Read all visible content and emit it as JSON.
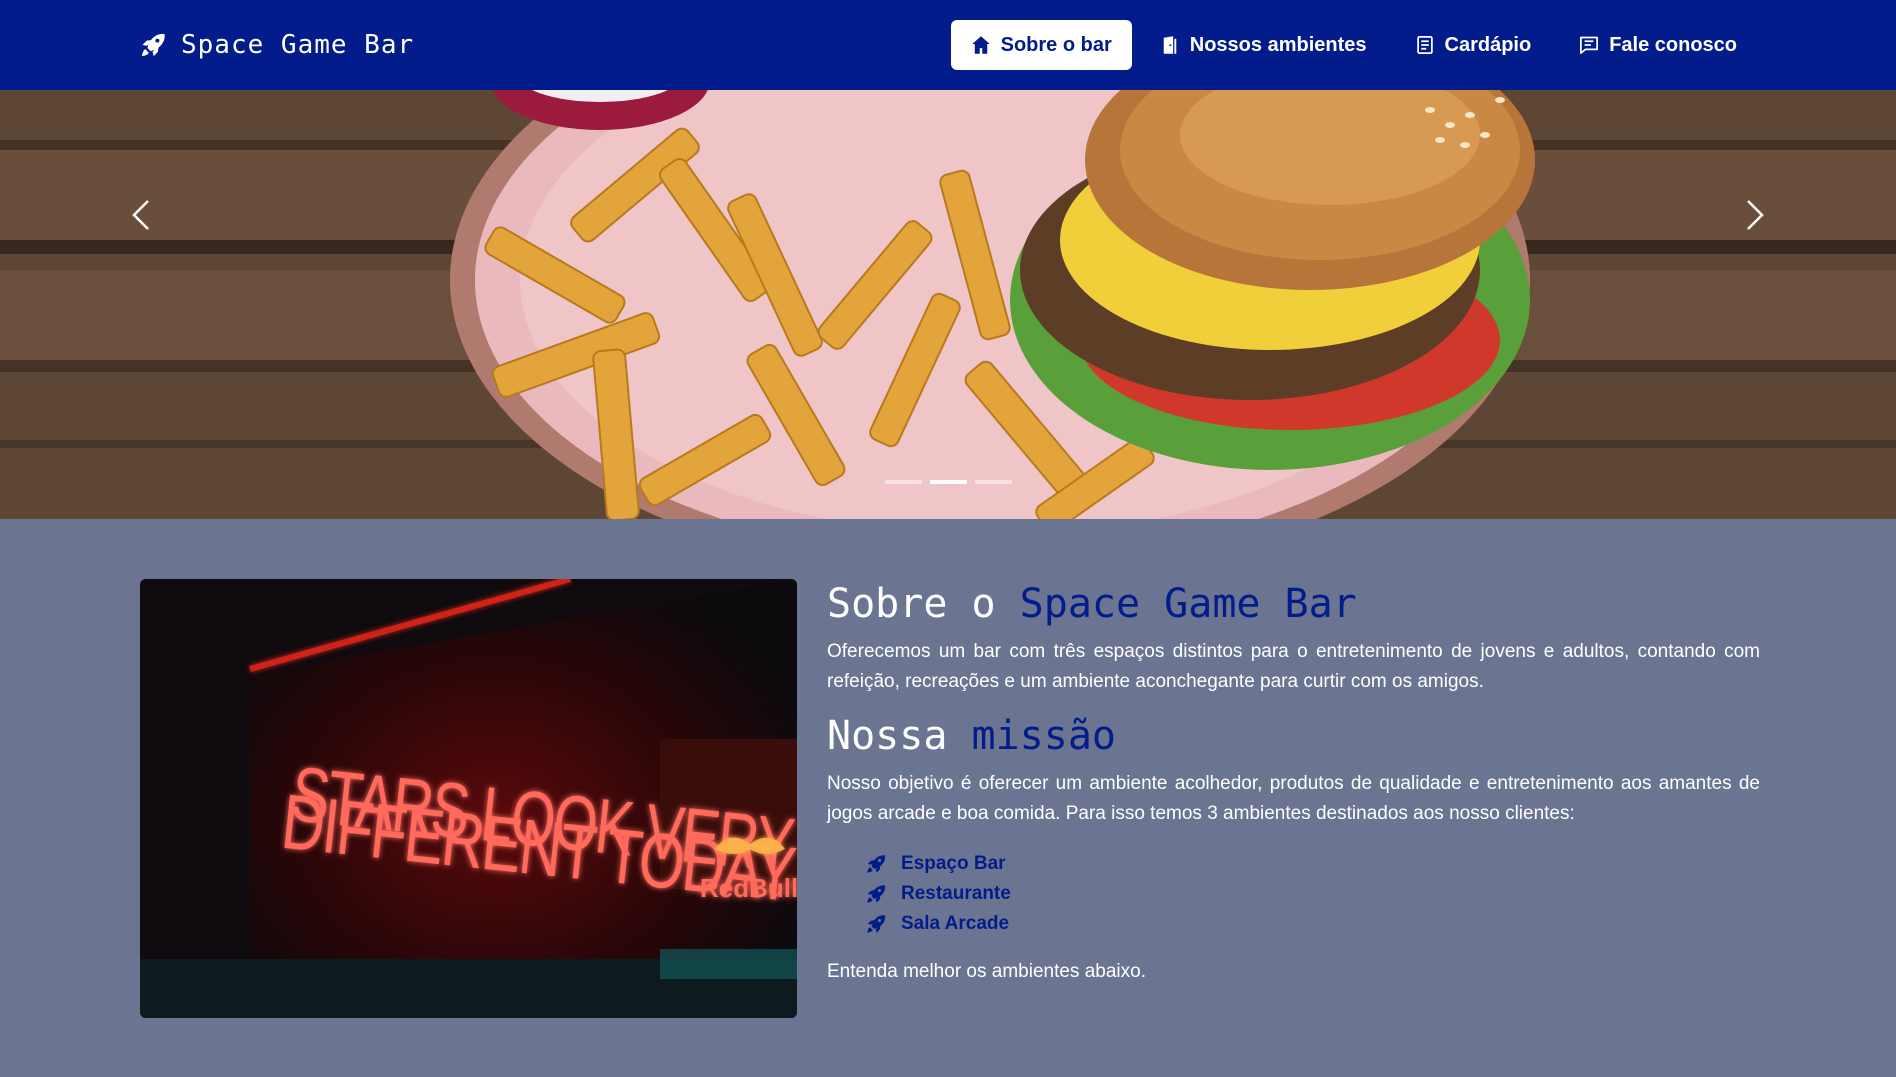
{
  "brand": {
    "name": "Space Game Bar",
    "icon": "rocket-icon"
  },
  "nav": {
    "items": [
      {
        "label": "Sobre o bar",
        "icon": "house-icon",
        "active": true
      },
      {
        "label": "Nossos ambientes",
        "icon": "door-icon",
        "active": false
      },
      {
        "label": "Cardápio",
        "icon": "menu-card-icon",
        "active": false
      },
      {
        "label": "Fale conosco",
        "icon": "chat-icon",
        "active": false
      }
    ]
  },
  "carousel": {
    "slide_count": 3,
    "active_slide": 2,
    "prev_icon": "chevron-left-icon",
    "next_icon": "chevron-right-icon"
  },
  "about": {
    "image_sign_line1": "STARS LOOK VERY",
    "image_sign_line2": "DIFFERENT TODAY",
    "image_logo_text": "RedBull",
    "title_prefix": "Sobre o ",
    "title_accent": "Space Game Bar",
    "description": "Oferecemos um bar com três espaços distintos para o entretenimento de jovens e adultos, contando com refeição, recreações e um ambiente aconchegante para curtir com os amigos.",
    "mission_prefix": "Nossa ",
    "mission_accent": "missão",
    "mission_text": "Nosso objetivo é oferecer um ambiente acolhedor, produtos de qualidade e entretenimento aos amantes de jogos arcade e boa comida. Para isso temos 3 ambientes destinados aos nosso clientes:",
    "environments": [
      "Espaço Bar",
      "Restaurante",
      "Sala Arcade"
    ],
    "closing": "Entenda melhor os ambientes abaixo."
  },
  "colors": {
    "navbar": "#021c8b",
    "accent": "#021c8b",
    "section_bg": "#6b7591",
    "text": "#ffffff"
  }
}
